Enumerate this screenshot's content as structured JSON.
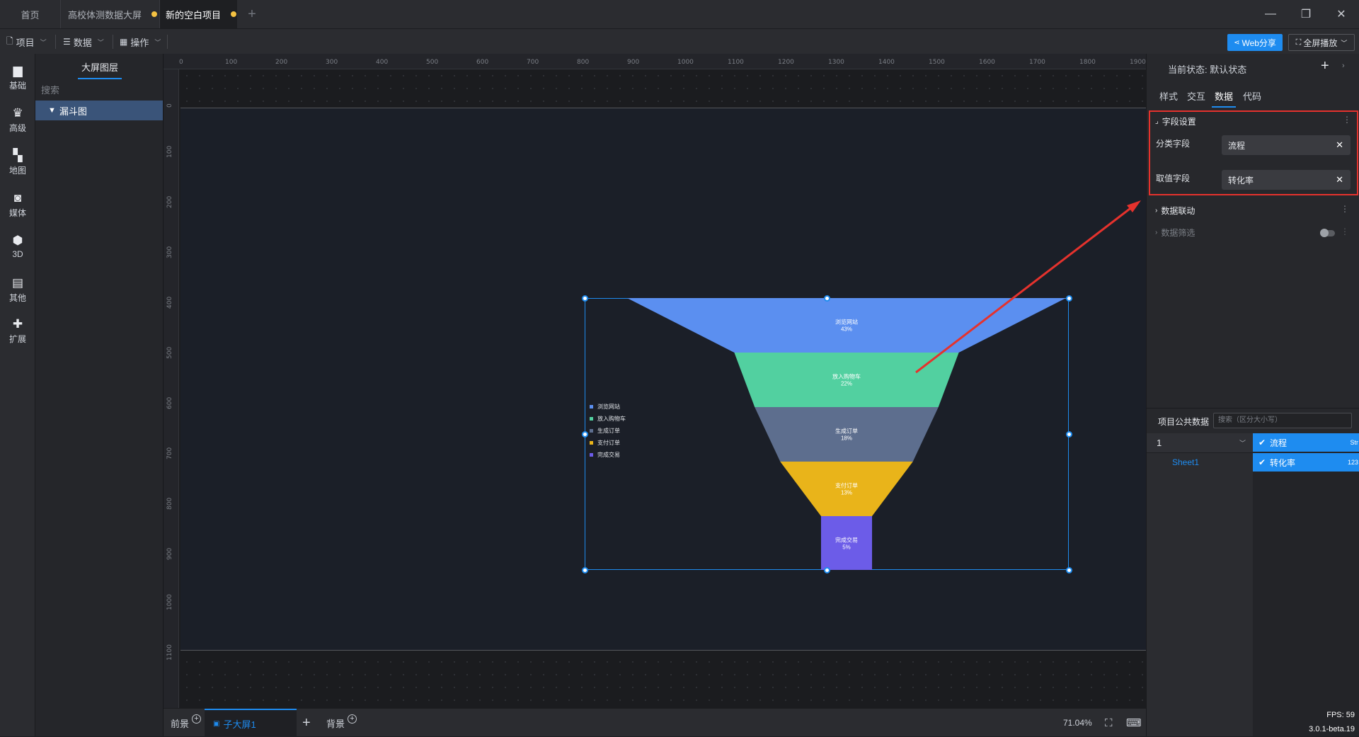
{
  "tabs": [
    {
      "label": "首页",
      "unsaved": false
    },
    {
      "label": "高校体测数据大屏",
      "unsaved": true
    },
    {
      "label": "新的空白项目",
      "unsaved": true,
      "active": true
    }
  ],
  "tab_add": "+",
  "window": {
    "min": "—",
    "restore": "❐",
    "close": "✕"
  },
  "toolbar": {
    "project": "项目",
    "data": "数据",
    "ops": "操作",
    "web_share": "Web分享",
    "fullscreen": "全屏播放"
  },
  "rail": [
    "基础",
    "高级",
    "地图",
    "媒体",
    "3D",
    "其他",
    "扩展"
  ],
  "layers": {
    "title": "大屏图层",
    "search": "搜索",
    "items": [
      "漏斗图"
    ]
  },
  "ruler": {
    "top": [
      "0",
      "100",
      "200",
      "300",
      "400",
      "500",
      "600",
      "700",
      "800",
      "900",
      "1000",
      "1100",
      "1200",
      "1300",
      "1400",
      "1500",
      "1600",
      "1700",
      "1800",
      "1900"
    ],
    "left": [
      "0",
      "100",
      "200",
      "300",
      "400",
      "500",
      "600",
      "700",
      "800",
      "900",
      "1000",
      "1100"
    ]
  },
  "chart_data": {
    "type": "funnel",
    "categories": [
      "浏览网站",
      "放入购物车",
      "生成订单",
      "支付订单",
      "完成交易"
    ],
    "values": [
      43,
      22,
      18,
      13,
      5
    ],
    "value_labels": [
      "43%",
      "22%",
      "18%",
      "13%",
      "5%"
    ],
    "colors": [
      "#5b8ff0",
      "#52d0a0",
      "#5d6e8e",
      "#e9b41a",
      "#6c5ce8"
    ],
    "legend": "left"
  },
  "bottom": {
    "front": "前景",
    "sub": "子大屏1",
    "add": "+",
    "bg": "背景",
    "zoom": "71.04%"
  },
  "right": {
    "state_label": "当前状态:",
    "state_value": "默认状态",
    "tabs": [
      "样式",
      "交互",
      "数据",
      "代码"
    ],
    "field_section": "字段设置",
    "category_label": "分类字段",
    "category_value": "流程",
    "value_label": "取值字段",
    "value_value": "转化率",
    "linkage": "数据联动",
    "filter": "数据筛选",
    "public_data": "项目公共数据",
    "public_search": "搜索（区分大小写）",
    "source": "1",
    "sheet": "Sheet1",
    "fields": [
      {
        "name": "流程",
        "type": "Str"
      },
      {
        "name": "转化率",
        "type": "123"
      }
    ]
  },
  "status": {
    "fps": "FPS: 59",
    "version": "3.0.1-beta.19"
  }
}
